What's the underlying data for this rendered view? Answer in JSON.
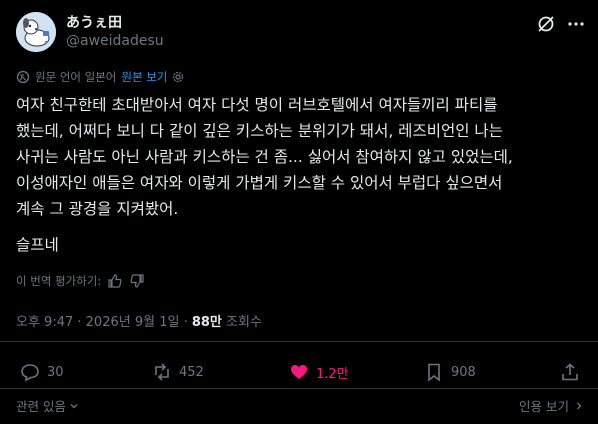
{
  "author": {
    "display_name": "あうぇ田",
    "handle": "@aweidadesu",
    "avatar_icon": "dog-avatar-icon"
  },
  "header_icons": {
    "grok": "grok-icon",
    "more": "more-icon"
  },
  "translation": {
    "label": "원문 언어 일본어",
    "show_original": "원본 보기",
    "icon": "translate-icon",
    "settings_icon": "gear-icon"
  },
  "post": {
    "lines": [
      "여자 친구한테 초대받아서 여자 다섯 명이 러브호텔에서 여자들끼리 파티를",
      "했는데, 어쩌다 보니 다 같이 깊은 키스하는 분위기가 돼서, 레즈비언인 나는",
      "사귀는 사람도 아닌 사람과 키스하는 건 좀... 싫어서 참여하지 않고 있었는데,",
      "이성애자인 애들은 여자와 이렇게 가볍게 키스할 수 있어서 부럽다 싶으면서",
      "계속 그 광경을 지켜봤어."
    ],
    "last_line": "슬프네"
  },
  "rate_translation": {
    "label": "이 번역 평가하기:"
  },
  "meta": {
    "time": "오후 9:47",
    "sep": " · ",
    "date": "2026년 9월 1일",
    "views_count": "88만",
    "views_label": " 조회수"
  },
  "actions": {
    "replies": "30",
    "reposts": "452",
    "likes": "1.2만",
    "bookmarks": "908"
  },
  "footer": {
    "related": "관련 있음",
    "quote_view": "인용 보기"
  },
  "colors": {
    "background": "#000000",
    "text": "#e7e9ea",
    "muted": "#71767b",
    "accent": "#1d9bf0",
    "like": "#f91880",
    "divider": "#2f3336"
  }
}
